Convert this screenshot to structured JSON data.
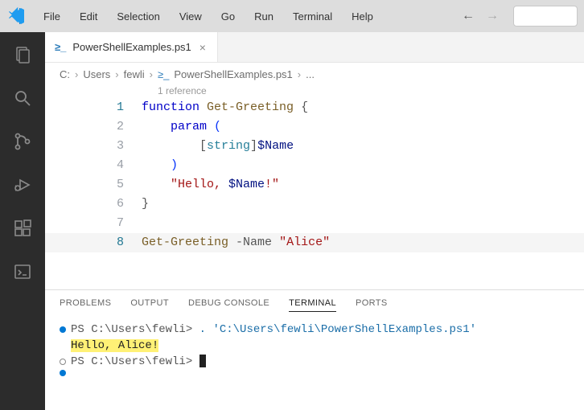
{
  "menu": [
    "File",
    "Edit",
    "Selection",
    "View",
    "Go",
    "Run",
    "Terminal",
    "Help"
  ],
  "tab": {
    "filename": "PowerShellExamples.ps1"
  },
  "breadcrumbs": [
    "C:",
    "Users",
    "fewli",
    "PowerShellExamples.ps1",
    "..."
  ],
  "codelens": "1 reference",
  "code": {
    "l1_kw": "function",
    "l1_fn": "Get-Greeting",
    "l1_brace": "{",
    "l2_kw": "param",
    "l2_paren": "(",
    "l3_lb": "[",
    "l3_type": "string",
    "l3_rb": "]",
    "l3_var": "$Name",
    "l4_paren": ")",
    "l5_str_open": "\"Hello, ",
    "l5_var": "$Name",
    "l5_str_close": "!\"",
    "l6_brace": "}",
    "l8_fn": "Get-Greeting",
    "l8_param": "-Name",
    "l8_str": "\"Alice\""
  },
  "line_numbers": [
    "1",
    "2",
    "3",
    "4",
    "5",
    "6",
    "7",
    "8"
  ],
  "panel": {
    "tabs": [
      "PROBLEMS",
      "OUTPUT",
      "DEBUG CONSOLE",
      "TERMINAL",
      "PORTS"
    ],
    "active": "TERMINAL"
  },
  "terminal": {
    "line1_prompt": "PS C:\\Users\\fewli> ",
    "line1_cmd": ". 'C:\\Users\\fewli\\PowerShellExamples.ps1'",
    "line2_out": "Hello, Alice!",
    "line3_prompt": "PS C:\\Users\\fewli> "
  }
}
